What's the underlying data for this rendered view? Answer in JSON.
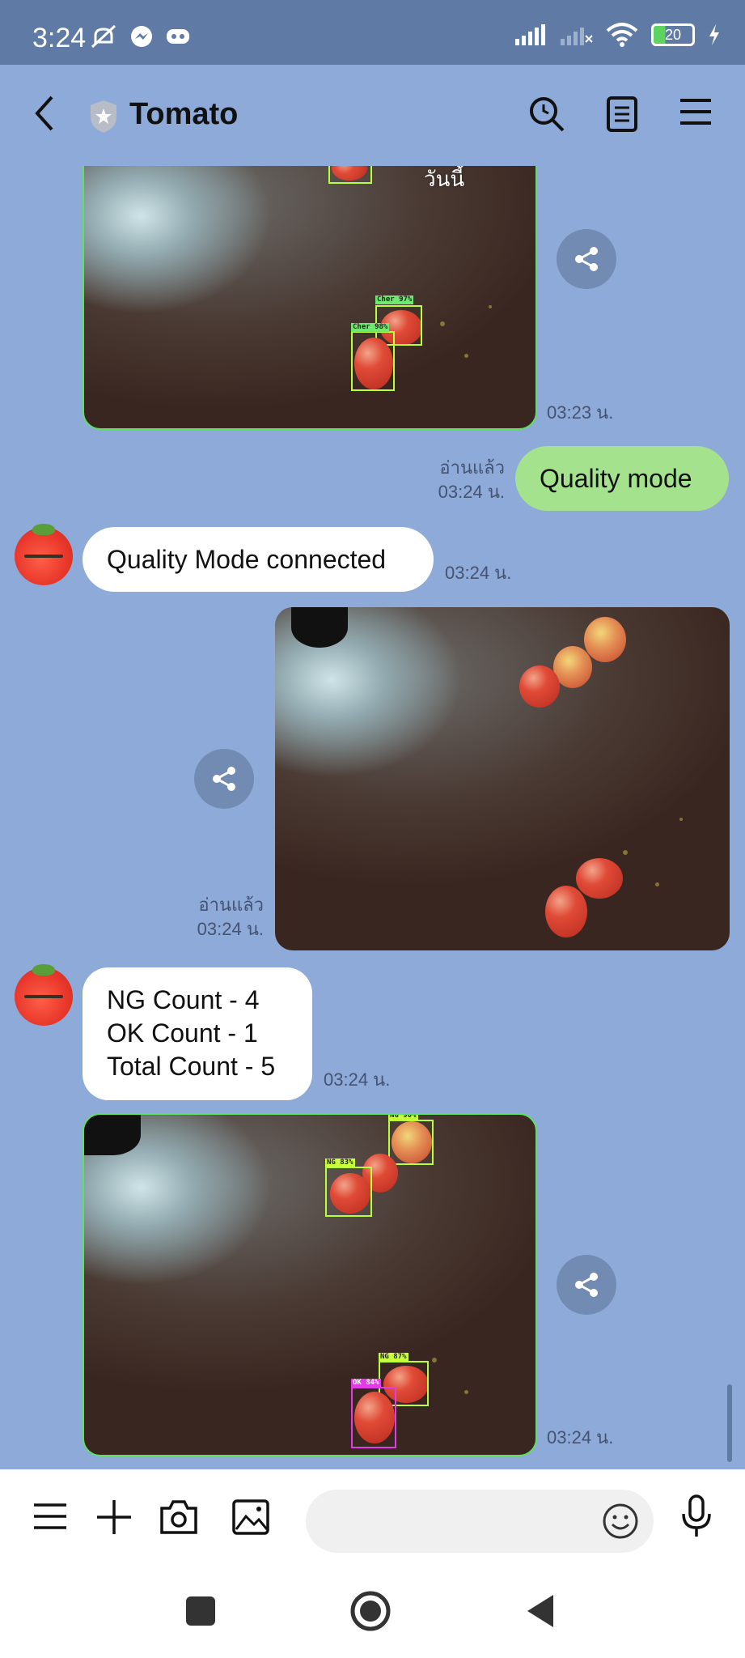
{
  "status_bar": {
    "time": "3:24",
    "battery": "20"
  },
  "header": {
    "title": "Tomato"
  },
  "messages": {
    "date_chip": "วันนี้",
    "photo1_time": "03:23 น.",
    "photo1_labels": [
      "Cher 97%",
      "Cher 98%"
    ],
    "quality_mode": {
      "text": "Quality mode",
      "read": "อ่านแล้ว",
      "time": "03:24 น."
    },
    "connected": {
      "text": "Quality Mode connected",
      "time": "03:24 น."
    },
    "photo2": {
      "read": "อ่านแล้ว",
      "time": "03:24 น."
    },
    "counts": {
      "line1": "NG Count - 4",
      "line2": "OK Count - 1",
      "line3": "Total Count - 5",
      "time": "03:24 น."
    },
    "photo3_time": "03:24 น.",
    "photo3_labels": [
      "NG 90%",
      "NG 83%",
      "NG 87%",
      "OK 84%"
    ]
  },
  "icons": {
    "header": [
      "back-icon",
      "shield-icon",
      "search-icon",
      "notes-icon",
      "menu-icon"
    ],
    "input": [
      "menu-icon",
      "plus-icon",
      "camera-icon",
      "image-icon",
      "emoji-icon",
      "mic-icon"
    ],
    "nav": [
      "square-icon",
      "home-icon",
      "back-triangle-icon"
    ]
  },
  "colors": {
    "chat_bg": "#8eaad8",
    "sent_bubble": "#a4e28d",
    "status_bar": "#5f7aa5"
  }
}
